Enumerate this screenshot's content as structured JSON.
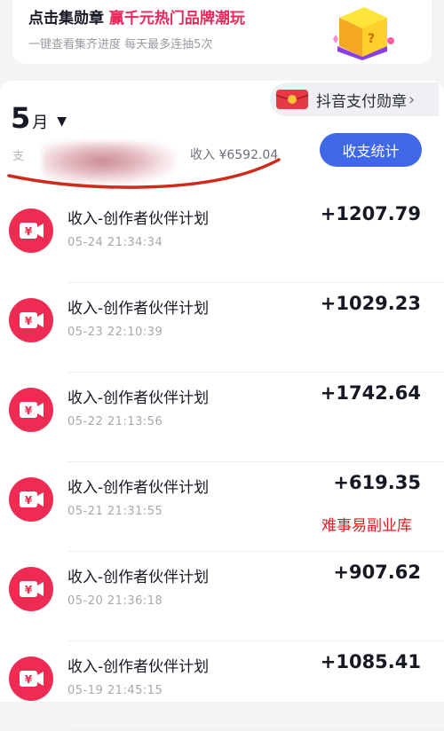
{
  "banner": {
    "title_prefix": "点击集勋章 ",
    "title_highlight": "赢千元热门品牌潮玩",
    "subtitle": "一键查看集齐进度  每天最多连抽5次",
    "gift_icon": "gift-box-icon"
  },
  "badge_link": {
    "label": "抖音支付勋章",
    "chevron": "›"
  },
  "month_selector": {
    "month": "5",
    "unit": "月",
    "arrow": "▼"
  },
  "summary": {
    "left_partial": "支",
    "income": "收入 ¥6592.04",
    "stats_button": "收支统计"
  },
  "transactions": [
    {
      "title": "收入-创作者伙伴计划",
      "time": "05-24 21:34:34",
      "amount": "+1207.79"
    },
    {
      "title": "收入-创作者伙伴计划",
      "time": "05-23 22:10:39",
      "amount": "+1029.23"
    },
    {
      "title": "收入-创作者伙伴计划",
      "time": "05-22 21:13:56",
      "amount": "+1742.64"
    },
    {
      "title": "收入-创作者伙伴计划",
      "time": "05-21 21:31:55",
      "amount": "+619.35"
    },
    {
      "title": "收入-创作者伙伴计划",
      "time": "05-20 21:36:18",
      "amount": "+907.62"
    },
    {
      "title": "收入-创作者伙伴计划",
      "time": "05-19 21:45:15",
      "amount": "+1085.41"
    }
  ],
  "watermark": "难事易副业库",
  "colors": {
    "accent": "#e8285a",
    "button": "#3f67e8",
    "icon_red": "#ee2b52",
    "stroke_red": "#d02a1c"
  }
}
